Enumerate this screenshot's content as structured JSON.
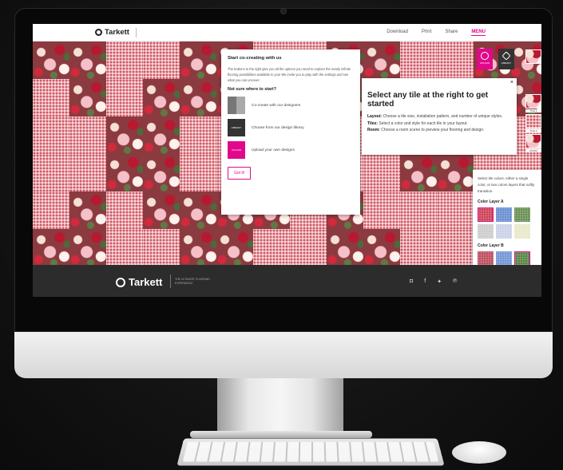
{
  "header": {
    "brand": "Tarkett",
    "nav": [
      "Download",
      "Print",
      "Share"
    ],
    "menu": "MENU"
  },
  "tools": {
    "upload": "UPLOAD",
    "library": "LIBRARY",
    "tile_labels": [
      "TILE 1",
      "TILE 2",
      "ROOM"
    ]
  },
  "cocreate": {
    "title": "Start co-creating with us",
    "intro": "The buttons to the right give you all the options you need to explore the nearly infinite flooring possibilities available to you! We invite you to play with the settings and see what you can uncover.",
    "subtitle": "Not sure where to start?",
    "options": [
      {
        "label": "Co-create with our designers",
        "icon": "faces-icon"
      },
      {
        "label": "Choose from our design library",
        "icon": "library-icon"
      },
      {
        "label": "Upload your own designs",
        "icon": "upload-icon"
      }
    ],
    "lib_icon_text": "LIBRARY",
    "upload_icon_text": "UPLOAD",
    "button": "Got it!"
  },
  "getstarted": {
    "close": "×",
    "title": "Select any tile at the right to get started",
    "layout_label": "Layout:",
    "layout_text": "Choose a tile size, installation pattern, and number of unique styles.",
    "tiles_label": "Tiles:",
    "tiles_text": "Select a color and style for each tile in your layout.",
    "room_label": "Room:",
    "room_text": "Choose a room scene to preview your flooring and design."
  },
  "colorpanel": {
    "hint": "Select tile colors, either a single color, or two colors layers that softly transition.",
    "layer_a": "Color Layer A",
    "layer_b": "Color Layer B",
    "colors_a": [
      "#c8374c",
      "#5f87cf",
      "#5e8a47",
      "#c9c9c9",
      "#c7cee6",
      "#e7e7c7"
    ],
    "colors_b": [
      "#b84555",
      "#6a8fd3",
      "#4f7d3b"
    ]
  },
  "footer": {
    "brand": "Tarkett",
    "tagline": "THE ULTIMATE FLOORING EXPERIENCE",
    "social": [
      "instagram-icon",
      "facebook-icon",
      "twitter-icon",
      "pinterest-icon"
    ]
  },
  "colors": {
    "accent": "#e2088b",
    "footer": "#2c2c2c"
  }
}
